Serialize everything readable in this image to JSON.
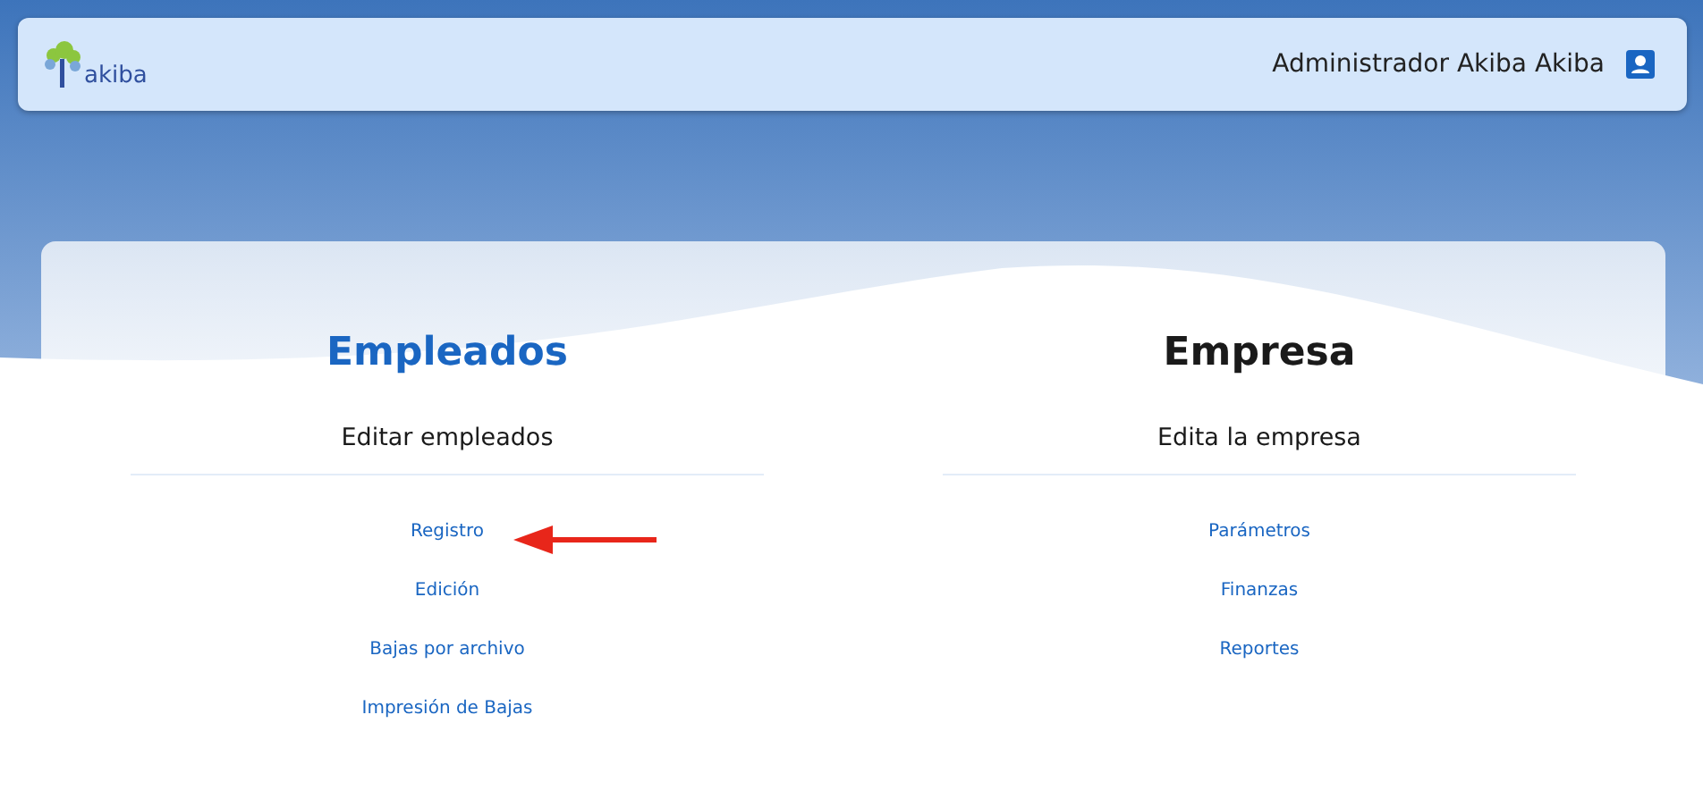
{
  "header": {
    "logo_text": "akiba",
    "user_name": "Administrador Akiba Akiba"
  },
  "sections": [
    {
      "title": "Empleados",
      "highlighted": true,
      "subtitle": "Editar empleados",
      "links": [
        "Registro",
        "Edición",
        "Bajas por archivo",
        "Impresión de Bajas"
      ]
    },
    {
      "title": "Empresa",
      "highlighted": false,
      "subtitle": "Edita la empresa",
      "links": [
        "Parámetros",
        "Finanzas",
        "Reportes"
      ]
    }
  ]
}
